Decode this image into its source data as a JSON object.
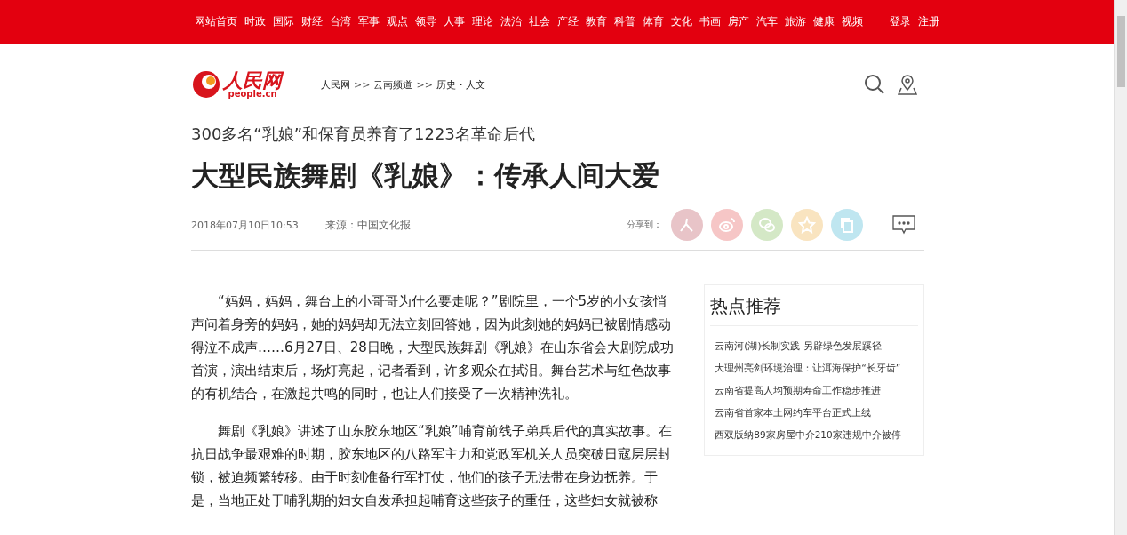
{
  "top_nav": {
    "items": [
      "网站首页",
      "时政",
      "国际",
      "财经",
      "台湾",
      "军事",
      "观点",
      "领导",
      "人事",
      "理论",
      "法治",
      "社会",
      "产经",
      "教育",
      "科普",
      "体育",
      "文化",
      "书画",
      "房产",
      "汽车",
      "旅游",
      "健康",
      "视频"
    ],
    "account_links": [
      "登录",
      "注册"
    ]
  },
  "logo": {
    "name": "人民网",
    "domain": "people.cn"
  },
  "breadcrumb": [
    "人民网",
    "云南频道",
    "历史・人文"
  ],
  "breadcrumb_separator": ">>",
  "article": {
    "subtitle": "300多名“乳娘”和保育员养育了1223名革命后代",
    "title": "大型民族舞剧《乳娘》：传承人间大爱",
    "date": "2018年07月10日10:53",
    "source": "来源：中国文化报",
    "share_label": "分享到：",
    "share_buttons": [
      {
        "kind": "people",
        "color": "#e8c4c8"
      },
      {
        "kind": "weibo",
        "color": "#f6c6c6"
      },
      {
        "kind": "wechat",
        "color": "#d4e8c6"
      },
      {
        "kind": "favorite",
        "color": "#f9e4c0"
      },
      {
        "kind": "copy",
        "color": "#bfe6f0"
      }
    ],
    "paragraphs": [
      "“妈妈，妈妈，舞台上的小哥哥为什么要走呢？”剧院里，一个5岁的小女孩悄声问着身旁的妈妈，她的妈妈却无法立刻回答她，因为此刻她的妈妈已被剧情感动得泣不成声……6月27日、28日晚，大型民族舞剧《乳娘》在山东省会大剧院成功首演，演出结束后，场灯亮起，记者看到，许多观众在拭泪。舞台艺术与红色故事的有机结合，在激起共鸣的同时，也让人们接受了一次精神洗礼。",
      "舞剧《乳娘》讲述了山东胶东地区“乳娘”哺育前线子弟兵后代的真实故事。在抗日战争最艰难的时期，胶东地区的八路军主力和党政军机关人员突破日寇层层封锁，被迫频繁转移。由于时刻准备行军打仗，他们的孩子无法带在身边抚养。于是，当地正处于哺乳期的妇女自发承担起哺育这些孩子的重任，这些妇女就被称"
    ]
  },
  "hot": {
    "title": "热点推荐",
    "items": [
      "云南河(湖)长制实践 另辟绿色发展蹊径",
      "大理州亮剑环境治理：让洱海保护“长牙齿”",
      "云南省提高人均预期寿命工作稳步推进",
      "云南省首家本土网约车平台正式上线",
      "西双版纳89家房屋中介210家违规中介被停"
    ]
  }
}
